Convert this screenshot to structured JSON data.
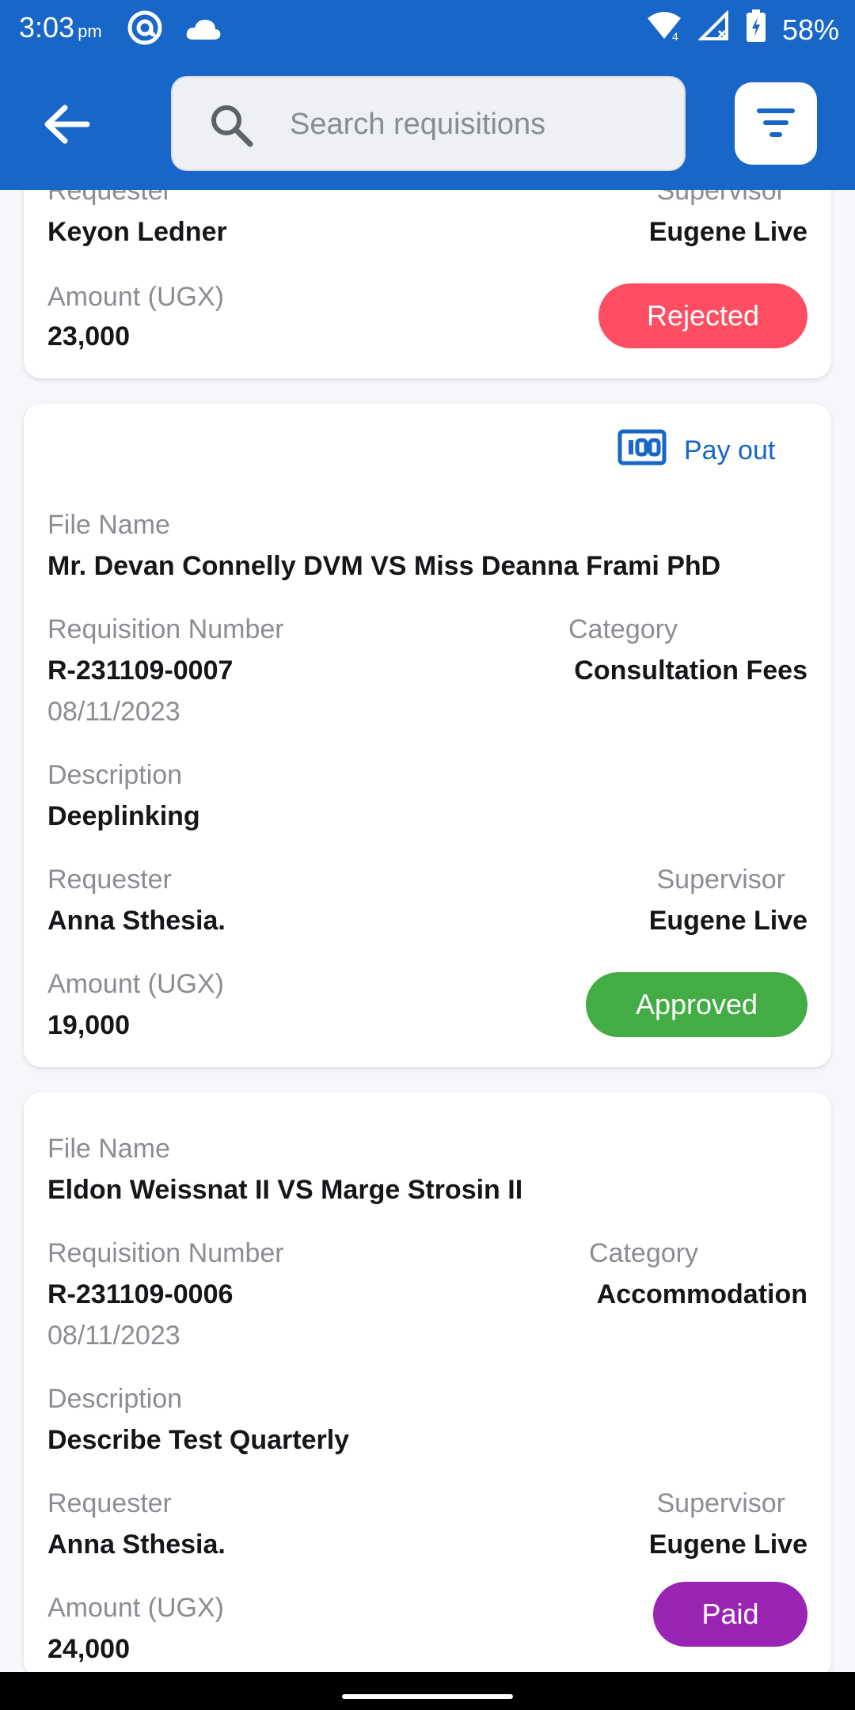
{
  "status": {
    "time": "3:03",
    "ampm": "pm",
    "battery": "58%",
    "icons": [
      "at-sign-icon",
      "cloud-icon",
      "wifi-icon",
      "signal-icon",
      "battery-icon"
    ]
  },
  "header": {
    "search_placeholder": "Search requisitions",
    "icons": [
      "back-arrow-icon",
      "search-icon",
      "filter-icon"
    ]
  },
  "colors": {
    "primary": "#1766c8",
    "rejected": "#ff4d62",
    "approved": "#43ac45",
    "paid": "#9a25b5"
  },
  "cards": [
    {
      "requester_label": "Requester",
      "requester": "Keyon Ledner",
      "supervisor_label": "Supervisor",
      "supervisor": "Eugene Live",
      "amount_label": "Amount (UGX)",
      "amount": "23,000",
      "status": "Rejected"
    },
    {
      "action": "Pay out",
      "action_icon": "banknote-icon",
      "file_label": "File Name",
      "file_name": "Mr. Devan Connelly DVM VS Miss Deanna Frami PhD",
      "req_label": "Requisition Number",
      "req_number": "R-231109-0007",
      "date": "08/11/2023",
      "category_label": "Category",
      "category": "Consultation Fees",
      "desc_label": "Description",
      "description": "Deeplinking",
      "requester_label": "Requester",
      "requester": "Anna Sthesia.",
      "supervisor_label": "Supervisor",
      "supervisor": "Eugene Live",
      "amount_label": "Amount (UGX)",
      "amount": "19,000",
      "status": "Approved"
    },
    {
      "file_label": "File Name",
      "file_name": "Eldon Weissnat II VS Marge Strosin II",
      "req_label": "Requisition Number",
      "req_number": "R-231109-0006",
      "date": "08/11/2023",
      "category_label": "Category",
      "category": "Accommodation",
      "desc_label": "Description",
      "description": "Describe Test Quarterly",
      "requester_label": "Requester",
      "requester": "Anna Sthesia.",
      "supervisor_label": "Supervisor",
      "supervisor": "Eugene Live",
      "amount_label": "Amount (UGX)",
      "amount": "24,000",
      "status": "Paid"
    }
  ]
}
